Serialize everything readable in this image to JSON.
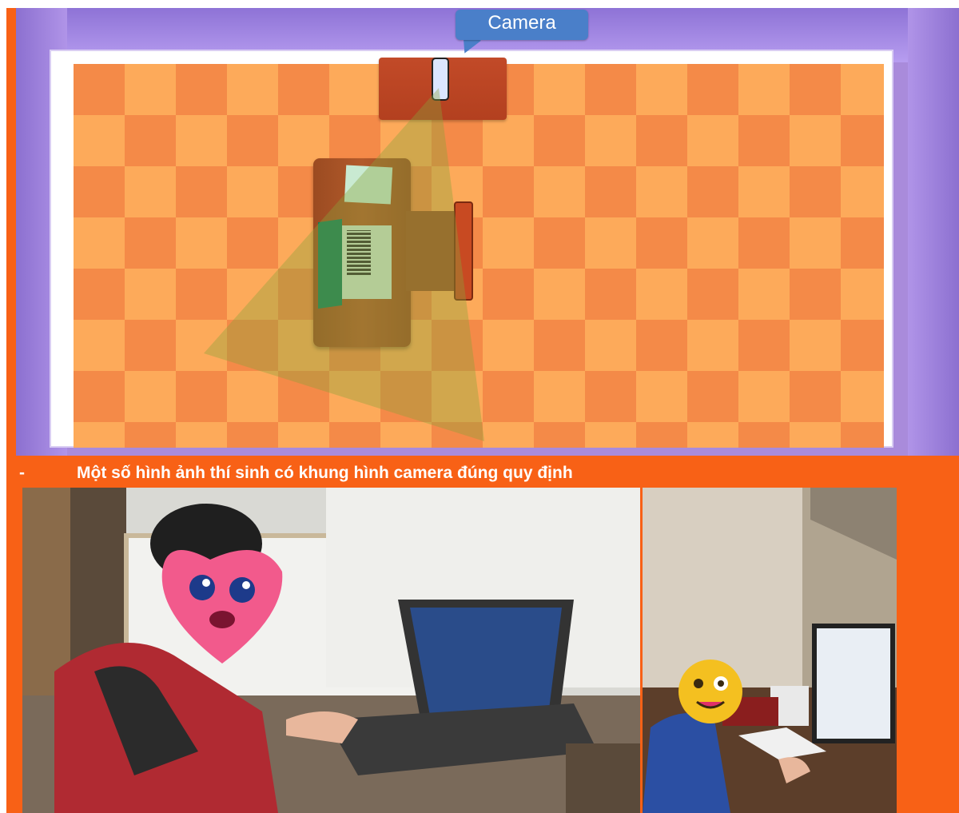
{
  "diagram": {
    "camera_label": "Camera"
  },
  "caption": {
    "bullet": "-",
    "text": "Một số hình ảnh thí sinh có khung hình camera đúng quy định"
  },
  "colors": {
    "background": "#f86116",
    "walls": "#a98bdb",
    "floor_light": "#fdaa5a",
    "floor_dark": "#f48a48",
    "camera_label": "#4a7fc9"
  }
}
